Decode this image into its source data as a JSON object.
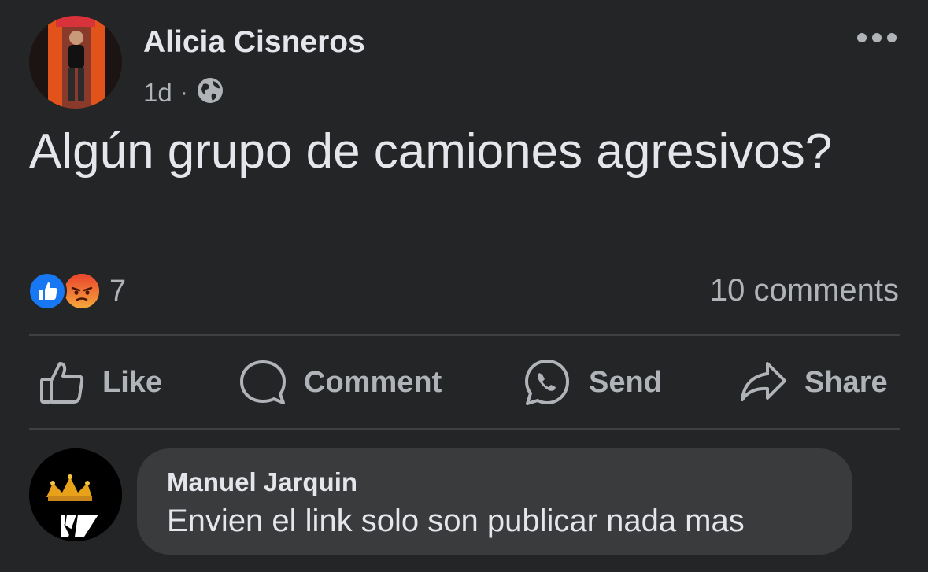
{
  "post": {
    "author": "Alicia Cisneros",
    "time": "1d",
    "separator": "·",
    "privacy_icon": "globe-icon",
    "text": "Algún grupo de camiones agresivos?",
    "reactions": {
      "types": [
        "like",
        "angry"
      ],
      "count": "7"
    },
    "comments_count": "10 comments"
  },
  "actions": {
    "like": "Like",
    "comment": "Comment",
    "send": "Send",
    "share": "Share"
  },
  "comment": {
    "author": "Manuel Jarquin",
    "text": "Envien el link solo son publicar nada mas"
  },
  "colors": {
    "background": "#242526",
    "text_primary": "#e4e6eb",
    "text_secondary": "#b0b3b8",
    "bubble": "#3a3b3c",
    "like_blue": "#1877f2",
    "angry_orange": "#f5843a"
  }
}
